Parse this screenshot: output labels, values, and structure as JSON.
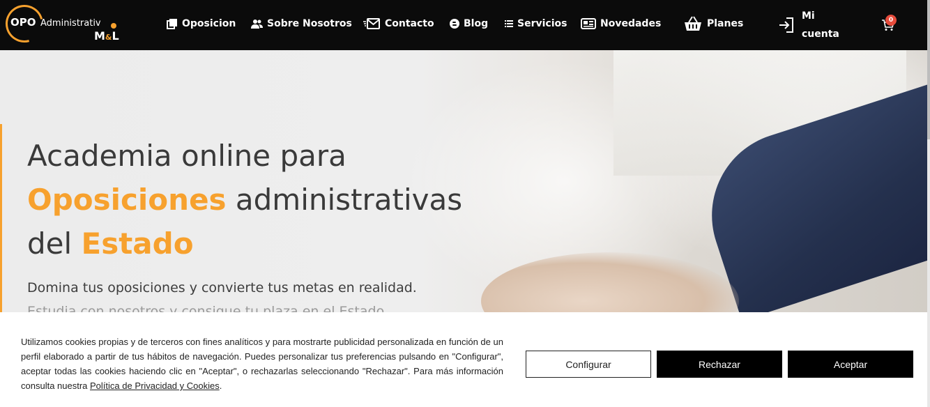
{
  "brand": {
    "logo_opo": "OPO",
    "logo_admin": "Administrativ",
    "logo_ml_m": "M",
    "logo_ml_amp": "&",
    "logo_ml_l": "L"
  },
  "nav": {
    "items": [
      {
        "label": "Oposicion",
        "icon": "book-stack-icon"
      },
      {
        "label": "Sobre Nosotros",
        "icon": "users-icon"
      },
      {
        "label": "Contacto",
        "icon": "envelope-icon"
      },
      {
        "label": "Blog",
        "icon": "blogger-icon"
      },
      {
        "label": "Servicios",
        "icon": "list-icon"
      },
      {
        "label": "Novedades",
        "icon": "newspaper-icon"
      },
      {
        "label": "Planes",
        "icon": "basket-icon"
      }
    ],
    "account_label_line1": "Mi",
    "account_label_line2": "cuenta",
    "cart_count": "0"
  },
  "hero": {
    "title_line1": "Academia online para",
    "title_accent1": "Oposiciones",
    "title_line2_rest": " administrativas",
    "title_line3_start": "del ",
    "title_accent2": "Estado",
    "subtitle": "Domina tus oposiciones y convierte tus metas en realidad.",
    "subtitle2": "Estudia con nosotros y consigue tu plaza en el Estado."
  },
  "cookie_banner": {
    "text": "Utilizamos cookies propias y de terceros con fines analíticos y para mostrarte publicidad personalizada en función de un perfil elaborado a partir de tus hábitos de navegación. Puedes personalizar tus preferencias pulsando en \"Configurar\", aceptar todas las cookies haciendo clic en \"Aceptar\", o rechazarlas seleccionando \"Rechazar\". Para más información consulta nuestra ",
    "link": "Política de Privacidad y Cookies",
    "text_end": ".",
    "btn_configure": "Configurar",
    "btn_reject": "Rechazar",
    "btn_accept": "Aceptar"
  },
  "colors": {
    "accent": "#f7a12e",
    "nav_bg": "#0b0b0b",
    "badge": "#e74c3c"
  }
}
